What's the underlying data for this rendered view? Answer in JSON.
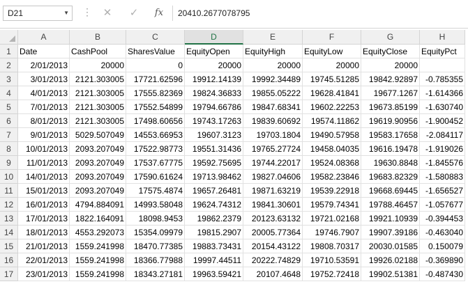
{
  "formula_bar": {
    "name_box": "D21",
    "cancel_icon": "✕",
    "enter_icon": "✓",
    "fx_label": "fx",
    "formula_value": "20410.2677078795"
  },
  "sheet": {
    "selected_column": "D",
    "columns": [
      "A",
      "B",
      "C",
      "D",
      "E",
      "F",
      "G",
      "H"
    ],
    "row_numbers": [
      "1",
      "2",
      "3",
      "4",
      "5",
      "6",
      "7",
      "8",
      "9",
      "10",
      "11",
      "12",
      "13",
      "14",
      "15",
      "16",
      "17"
    ],
    "rows": [
      [
        "Date",
        "CashPool",
        "SharesValue",
        "EquityOpen",
        "EquityHigh",
        "EquityLow",
        "EquityClose",
        "EquityPct"
      ],
      [
        "2/01/2013",
        "20000",
        "0",
        "20000",
        "20000",
        "20000",
        "20000",
        ""
      ],
      [
        "3/01/2013",
        "2121.303005",
        "17721.62596",
        "19912.14139",
        "19992.34489",
        "19745.51285",
        "19842.92897",
        "-0.785355"
      ],
      [
        "4/01/2013",
        "2121.303005",
        "17555.82369",
        "19824.36833",
        "19855.05222",
        "19628.41841",
        "19677.1267",
        "-1.614366"
      ],
      [
        "7/01/2013",
        "2121.303005",
        "17552.54899",
        "19794.66786",
        "19847.68341",
        "19602.22253",
        "19673.85199",
        "-1.630740"
      ],
      [
        "8/01/2013",
        "2121.303005",
        "17498.60656",
        "19743.17263",
        "19839.60692",
        "19574.11862",
        "19619.90956",
        "-1.900452"
      ],
      [
        "9/01/2013",
        "5029.507049",
        "14553.66953",
        "19607.3123",
        "19703.1804",
        "19490.57958",
        "19583.17658",
        "-2.084117"
      ],
      [
        "10/01/2013",
        "2093.207049",
        "17522.98773",
        "19551.31436",
        "19765.27724",
        "19458.04035",
        "19616.19478",
        "-1.919026"
      ],
      [
        "11/01/2013",
        "2093.207049",
        "17537.67775",
        "19592.75695",
        "19744.22017",
        "19524.08368",
        "19630.8848",
        "-1.845576"
      ],
      [
        "14/01/2013",
        "2093.207049",
        "17590.61624",
        "19713.98462",
        "19827.04606",
        "19582.23846",
        "19683.82329",
        "-1.580883"
      ],
      [
        "15/01/2013",
        "2093.207049",
        "17575.4874",
        "19657.26481",
        "19871.63219",
        "19539.22918",
        "19668.69445",
        "-1.656527"
      ],
      [
        "16/01/2013",
        "4794.884091",
        "14993.58048",
        "19624.74312",
        "19841.30601",
        "19579.74341",
        "19788.46457",
        "-1.057677"
      ],
      [
        "17/01/2013",
        "1822.164091",
        "18098.9453",
        "19862.2379",
        "20123.63132",
        "19721.02168",
        "19921.10939",
        "-0.394453"
      ],
      [
        "18/01/2013",
        "4553.292073",
        "15354.09979",
        "19815.2907",
        "20005.77364",
        "19746.7907",
        "19907.39186",
        "-0.463040"
      ],
      [
        "21/01/2013",
        "1559.241998",
        "18470.77385",
        "19883.73431",
        "20154.43122",
        "19808.70317",
        "20030.01585",
        "0.150079"
      ],
      [
        "22/01/2013",
        "1559.241998",
        "18366.77988",
        "19997.44511",
        "20222.74829",
        "19710.53591",
        "19926.02188",
        "-0.369890"
      ],
      [
        "23/01/2013",
        "1559.241998",
        "18343.27181",
        "19963.59421",
        "20107.4648",
        "19752.72418",
        "19902.51381",
        "-0.487430"
      ]
    ]
  }
}
